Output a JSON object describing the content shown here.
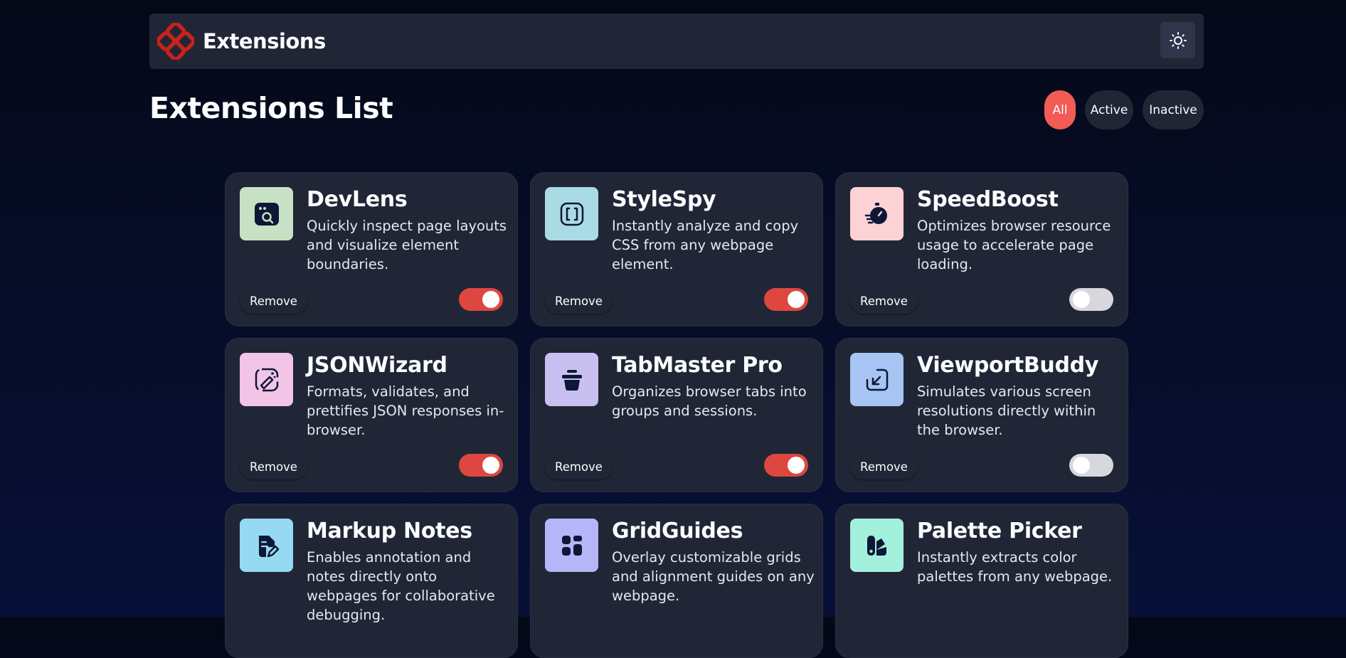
{
  "header": {
    "brand": "Extensions"
  },
  "page_title": "Extensions List",
  "filters": [
    {
      "label": "All",
      "active": true
    },
    {
      "label": "Active",
      "active": false
    },
    {
      "label": "Inactive",
      "active": false
    }
  ],
  "remove_label": "Remove",
  "colors": {
    "accent": "#f25c54",
    "toggle_on": "#de473f",
    "card_bg": "#212636"
  },
  "extensions": [
    {
      "name": "DevLens",
      "description": "Quickly inspect page layouts and visualize element boundaries.",
      "icon": "browser-search-icon",
      "icon_bg": "#c7e1c4",
      "enabled": true
    },
    {
      "name": "StyleSpy",
      "description": "Instantly analyze and copy CSS from any webpage element.",
      "icon": "brackets-icon",
      "icon_bg": "#a9dbe4",
      "enabled": true
    },
    {
      "name": "SpeedBoost",
      "description": "Optimizes browser resource usage to accelerate page loading.",
      "icon": "stopwatch-icon",
      "icon_bg": "#fdd2d5",
      "enabled": false
    },
    {
      "name": "JSONWizard",
      "description": "Formats, validates, and prettifies JSON responses in-browser.",
      "icon": "wand-icon",
      "icon_bg": "#f2c4e6",
      "enabled": true
    },
    {
      "name": "TabMaster Pro",
      "description": "Organizes browser tabs into groups and sessions.",
      "icon": "box-icon",
      "icon_bg": "#c9c0f2",
      "enabled": true
    },
    {
      "name": "ViewportBuddy",
      "description": "Simulates various screen resolutions directly within the browser.",
      "icon": "resize-icon",
      "icon_bg": "#a7c5f2",
      "enabled": false
    },
    {
      "name": "Markup Notes",
      "description": "Enables annotation and notes directly onto webpages for collaborative debugging.",
      "icon": "note-edit-icon",
      "icon_bg": "#95d9f2",
      "enabled": null
    },
    {
      "name": "GridGuides",
      "description": "Overlay customizable grids and alignment guides on any webpage.",
      "icon": "grid-icon",
      "icon_bg": "#b4b6f7",
      "enabled": null
    },
    {
      "name": "Palette Picker",
      "description": "Instantly extracts color palettes from any webpage.",
      "icon": "palette-icon",
      "icon_bg": "#a3f0dc",
      "enabled": null
    }
  ]
}
